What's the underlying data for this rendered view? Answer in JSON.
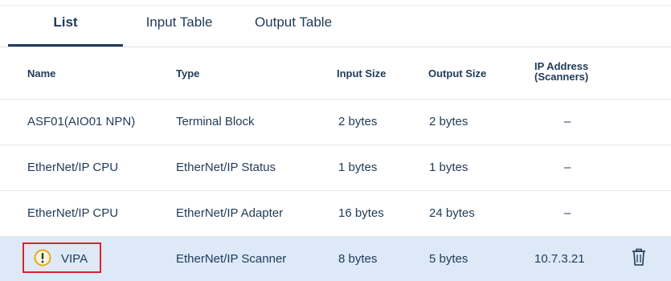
{
  "tabs": [
    {
      "label": "List",
      "active": true
    },
    {
      "label": "Input Table",
      "active": false
    },
    {
      "label": "Output Table",
      "active": false
    }
  ],
  "columns": {
    "name": "Name",
    "type": "Type",
    "input_size": "Input Size",
    "output_size": "Output Size",
    "ip_line1": "IP Address",
    "ip_line2": "(Scanners)"
  },
  "rows": [
    {
      "name": "ASF01(AIO01 NPN)",
      "type": "Terminal Block",
      "input_size": "2 bytes",
      "output_size": "2 bytes",
      "ip": "–"
    },
    {
      "name": "EtherNet/IP CPU",
      "type": "EtherNet/IP Status",
      "input_size": "1 bytes",
      "output_size": "1 bytes",
      "ip": "–"
    },
    {
      "name": "EtherNet/IP CPU",
      "type": "EtherNet/IP Adapter",
      "input_size": "16 bytes",
      "output_size": "24 bytes",
      "ip": "–"
    },
    {
      "name": "VIPA",
      "type": "EtherNet/IP Scanner",
      "input_size": "8 bytes",
      "output_size": "5 bytes",
      "ip": "10.7.3.21",
      "selected": true,
      "icon": "warning-icon",
      "action_icon": "trash-icon"
    }
  ],
  "colors": {
    "text": "#1f3a58",
    "selected_row": "#dde9f7",
    "warning": "#e6a817",
    "highlight_box": "#d8252a"
  }
}
